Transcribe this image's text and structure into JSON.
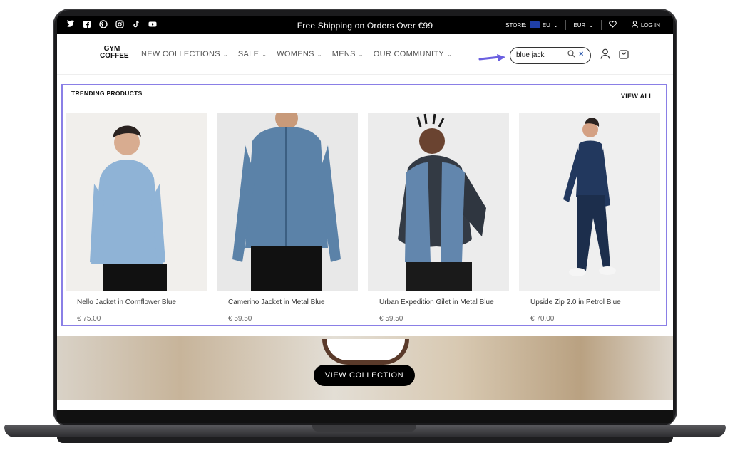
{
  "announcement": {
    "promo": "Free Shipping on Orders Over €99",
    "store_label": "STORE:",
    "region": "EU",
    "currency": "EUR",
    "login": "LOG IN"
  },
  "social_icons": [
    "twitter-icon",
    "facebook-icon",
    "pinterest-icon",
    "instagram-icon",
    "tiktok-icon",
    "youtube-icon"
  ],
  "header": {
    "logo_line1": "GYM",
    "logo_line2": "COFFEE",
    "nav": [
      "NEW COLLECTIONS",
      "SALE",
      "WOMENS",
      "MENS",
      "OUR COMMUNITY"
    ],
    "search_value": "blue jack"
  },
  "trending": {
    "title": "TRENDING PRODUCTS",
    "view_all": "VIEW ALL",
    "products": [
      {
        "name": "Nello Jacket in Cornflower Blue",
        "price": "€ 75.00",
        "color": "#8fb3d6"
      },
      {
        "name": "Camerino Jacket in Metal Blue",
        "price": "€ 59.50",
        "color": "#5b82a8"
      },
      {
        "name": "Urban Expedition Gilet in Metal Blue",
        "price": "€ 59.50",
        "color": "#6286ad"
      },
      {
        "name": "Upside Zip 2.0 in Petrol Blue",
        "price": "€ 70.00",
        "color": "#22385e"
      }
    ]
  },
  "hero": {
    "button": "VIEW COLLECTION"
  },
  "colors": {
    "accent_outline": "#8a7fe6",
    "black": "#000000"
  }
}
